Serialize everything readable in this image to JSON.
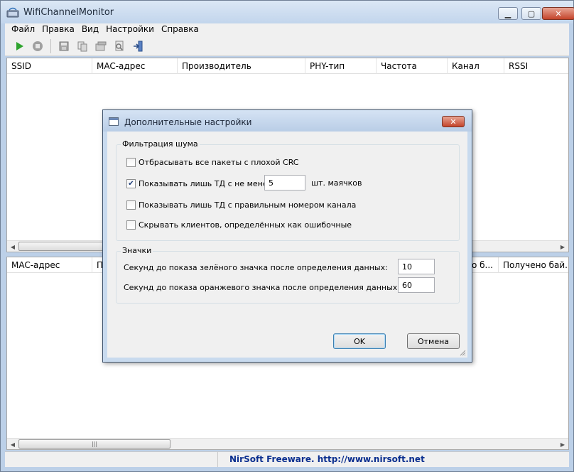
{
  "window": {
    "title": "WifiChannelMonitor"
  },
  "menu": [
    "Файл",
    "Правка",
    "Вид",
    "Настройки",
    "Справка"
  ],
  "toolbar_icons": [
    "play-icon",
    "stop-icon",
    "save-icon",
    "copy-icon",
    "properties-icon",
    "search-icon",
    "exit-icon"
  ],
  "top_table": {
    "columns": [
      "SSID",
      "MAC-адрес",
      "Производитель",
      "PHY-тип",
      "Частота",
      "Канал",
      "RSSI"
    ]
  },
  "bottom_table": {
    "columns": [
      "MAC-адрес",
      "П",
      "о б...",
      "Получено бай..."
    ]
  },
  "status": {
    "text": "NirSoft Freeware.  http://www.nirsoft.net"
  },
  "dialog": {
    "title": "Дополнительные настройки",
    "noise_group": {
      "title": "Фильтрация шума",
      "drop_bad_crc": {
        "label": "Отбрасывать все пакеты с плохой CRC",
        "checked": false
      },
      "show_min_beacons": {
        "label": "Показывать лишь ТД с не менее",
        "checked": true,
        "value": "5",
        "suffix": "шт. маячков"
      },
      "correct_channel": {
        "label": "Показывать лишь ТД с правильным номером канала",
        "checked": false
      },
      "hide_wrong_clients": {
        "label": "Скрывать клиентов, определённых как ошибочные",
        "checked": false
      }
    },
    "icons_group": {
      "title": "Значки",
      "green_label": "Секунд до показа зелёного значка после определения данных:",
      "green_value": "10",
      "orange_label": "Секунд до показа оранжевого значка после определения данных:",
      "orange_value": "60"
    },
    "ok_label": "OK",
    "cancel_label": "Отмена"
  }
}
